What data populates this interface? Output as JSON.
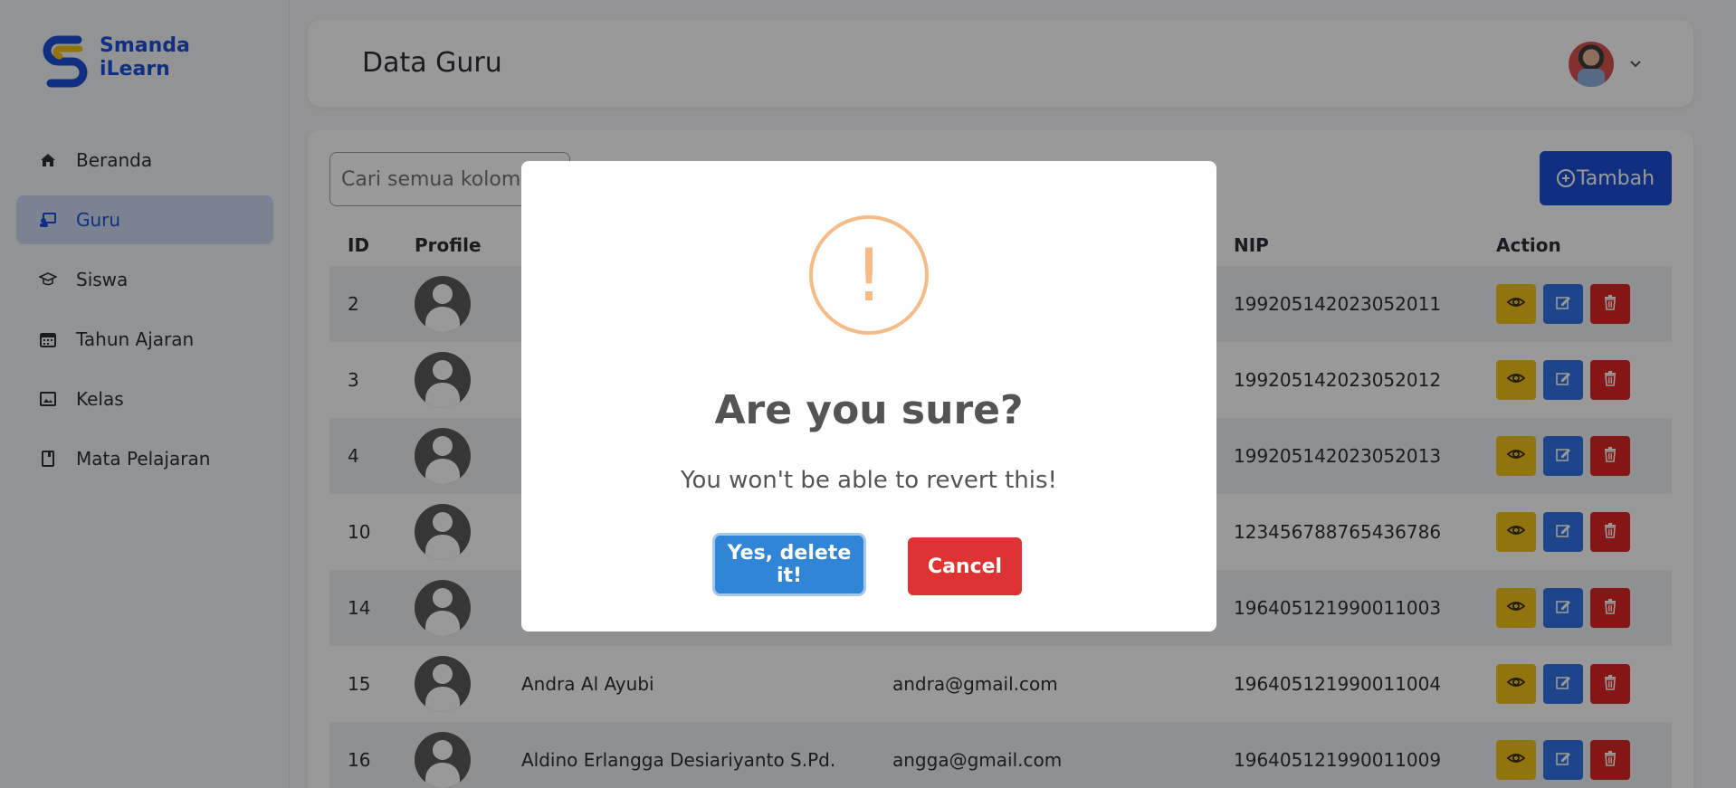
{
  "app": {
    "logo_line1": "Smanda",
    "logo_line2": "iLearn"
  },
  "sidebar": {
    "items": [
      {
        "label": "Beranda",
        "icon": "home-icon"
      },
      {
        "label": "Guru",
        "icon": "teacher-icon",
        "active": true
      },
      {
        "label": "Siswa",
        "icon": "graduation-cap-icon"
      },
      {
        "label": "Tahun Ajaran",
        "icon": "calendar-icon"
      },
      {
        "label": "Kelas",
        "icon": "classroom-icon"
      },
      {
        "label": "Mata Pelajaran",
        "icon": "book-icon"
      }
    ]
  },
  "header": {
    "title": "Data Guru"
  },
  "toolbar": {
    "search_placeholder": "Cari semua kolom...",
    "add_label": "Tambah"
  },
  "table": {
    "columns": {
      "id": "ID",
      "profile": "Profile",
      "nip": "NIP",
      "action": "Action"
    },
    "rows": [
      {
        "id": "2",
        "name": "",
        "email": "",
        "nip": "199205142023052011"
      },
      {
        "id": "3",
        "name": "",
        "email": "",
        "nip": "199205142023052012"
      },
      {
        "id": "4",
        "name": "",
        "email": "",
        "nip": "199205142023052013"
      },
      {
        "id": "10",
        "name": "",
        "email": "",
        "nip": "123456788765436786"
      },
      {
        "id": "14",
        "name": "",
        "email": "",
        "nip": "196405121990011003"
      },
      {
        "id": "15",
        "name": "Andra Al Ayubi",
        "email": "andra@gmail.com",
        "nip": "196405121990011004"
      },
      {
        "id": "16",
        "name": "Aldino Erlangga Desiariyanto S.Pd.",
        "email": "angga@gmail.com",
        "nip": "196405121990011009"
      }
    ]
  },
  "modal": {
    "icon": "!",
    "title": "Are you sure?",
    "text": "You won't be able to revert this!",
    "confirm_label": "Yes, delete it!",
    "cancel_label": "Cancel"
  },
  "colors": {
    "primary": "#1d4fd8",
    "view": "#f4c21a",
    "edit": "#2f74ea",
    "delete": "#e02424",
    "confirm": "#3085d6",
    "cancel": "#dd3333",
    "warning": "#f8bb86"
  }
}
